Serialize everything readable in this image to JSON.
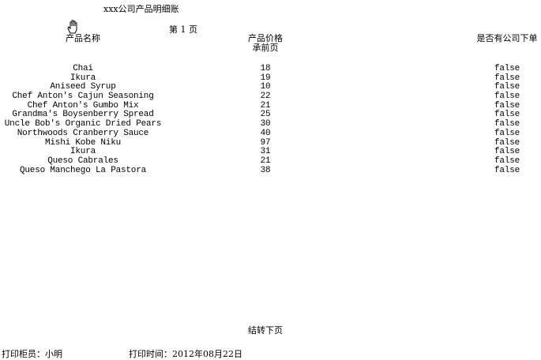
{
  "report": {
    "title": "xxx公司产品明细账",
    "page_label": "第 1 页",
    "headers": {
      "name": "产品名称",
      "price": "产品价格",
      "on_order": "是否有公司下单"
    },
    "carry_forward": "承前页",
    "rows": [
      {
        "name": "Chai",
        "price": "18",
        "flag": "false"
      },
      {
        "name": "Ikura",
        "price": "19",
        "flag": "false"
      },
      {
        "name": "Aniseed Syrup",
        "price": "10",
        "flag": "false"
      },
      {
        "name": "Chef Anton's Cajun Seasoning",
        "price": "22",
        "flag": "false"
      },
      {
        "name": "Chef Anton's Gumbo Mix",
        "price": "21",
        "flag": "false"
      },
      {
        "name": "Grandma's Boysenberry Spread",
        "price": "25",
        "flag": "false"
      },
      {
        "name": "Uncle Bob's Organic Dried Pears",
        "price": "30",
        "flag": "false"
      },
      {
        "name": "Northwoods Cranberry Sauce",
        "price": "40",
        "flag": "false"
      },
      {
        "name": "Mishi Kobe Niku",
        "price": "97",
        "flag": "false"
      },
      {
        "name": "Ikura",
        "price": "31",
        "flag": "false"
      },
      {
        "name": "Queso Cabrales",
        "price": "21",
        "flag": "false"
      },
      {
        "name": "Queso Manchego La Pastora",
        "price": "38",
        "flag": "false"
      }
    ],
    "carry_next": "结转下页",
    "printer": "打印柜员：小明",
    "print_time": "打印时间：2012年08月22日"
  }
}
